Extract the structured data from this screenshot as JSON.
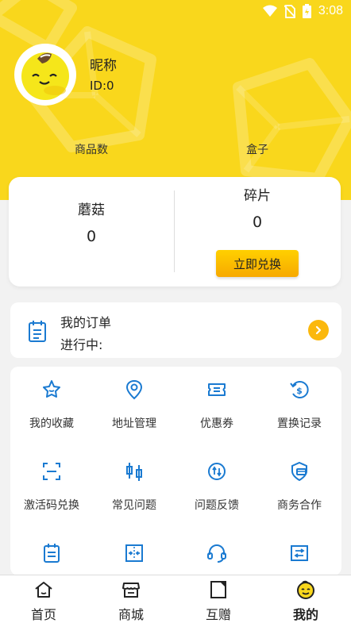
{
  "status_bar": {
    "time": "3:08"
  },
  "profile": {
    "nickname": "昵称",
    "user_id": "ID:0",
    "stats": [
      "商品数",
      "盒子"
    ]
  },
  "balance": {
    "mushroom_label": "蘑菇",
    "mushroom_value": "0",
    "fragment_label": "碎片",
    "fragment_value": "0",
    "exchange_button": "立即兑换"
  },
  "order": {
    "title": "我的订单",
    "status": "进行中:"
  },
  "menu": [
    {
      "label": "我的收藏",
      "icon": "star-icon"
    },
    {
      "label": "地址管理",
      "icon": "location-icon"
    },
    {
      "label": "优惠券",
      "icon": "coupon-icon"
    },
    {
      "label": "置换记录",
      "icon": "exchange-record-icon"
    },
    {
      "label": "激活码兑换",
      "icon": "scan-icon"
    },
    {
      "label": "常见问题",
      "icon": "faq-icon"
    },
    {
      "label": "问题反馈",
      "icon": "feedback-icon"
    },
    {
      "label": "商务合作",
      "icon": "cooperation-icon"
    },
    {
      "label": "",
      "icon": "clipboard-icon"
    },
    {
      "label": "",
      "icon": "compress-icon"
    },
    {
      "label": "",
      "icon": "headset-icon"
    },
    {
      "label": "",
      "icon": "swap-icon"
    }
  ],
  "tabs": [
    {
      "label": "首页",
      "icon": "home-icon"
    },
    {
      "label": "商城",
      "icon": "store-icon"
    },
    {
      "label": "互赠",
      "icon": "gift-card-icon"
    },
    {
      "label": "我的",
      "icon": "smiley-icon",
      "active": true
    }
  ],
  "colors": {
    "header_yellow": "#f9d71c",
    "icon_blue": "#1a7ad1",
    "button_orange": "#f7a900",
    "arrow_orange": "#fbb80d"
  }
}
